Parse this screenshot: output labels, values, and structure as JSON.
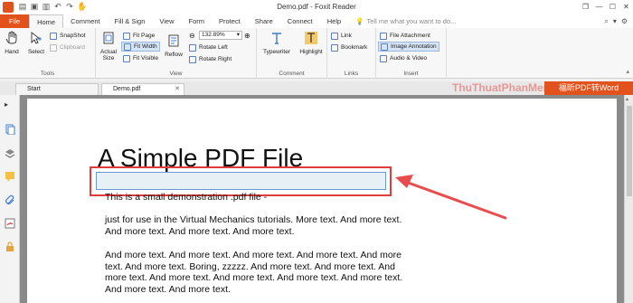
{
  "window": {
    "title": "Demo.pdf - Foxit Reader"
  },
  "qat_icons": [
    "open-icon",
    "save-icon",
    "print-icon",
    "undo-icon",
    "redo-icon",
    "hand-tool-icon"
  ],
  "window_controls": [
    "restore-icon",
    "minimize-icon",
    "maximize-icon",
    "close-icon"
  ],
  "tabs": [
    "File",
    "Home",
    "Comment",
    "Fill & Sign",
    "View",
    "Form",
    "Protect",
    "Share",
    "Connect",
    "Help"
  ],
  "active_tab": "Home",
  "tell_me": {
    "placeholder": "Tell me what you want to do..."
  },
  "ribbon": {
    "tools": {
      "label": "Tools",
      "hand": "Hand",
      "select": "Select",
      "snapshot": "SnapShot",
      "clipboard": "Clipboard"
    },
    "view": {
      "label": "View",
      "actual_size": [
        "Actual",
        "Size"
      ],
      "fit_page": "Fit Page",
      "fit_width": "Fit Width",
      "fit_visible": "Fit Visible",
      "reflow": "Reflow",
      "zoom": "132.89%",
      "rotate_left": "Rotate Left",
      "rotate_right": "Rotate Right"
    },
    "comment": {
      "label": "Comment",
      "typewriter": "Typewriter",
      "highlight": "Highlight"
    },
    "links": {
      "label": "Links",
      "link": "Link",
      "bookmark": "Bookmark"
    },
    "insert": {
      "label": "Insert",
      "file_attachment": "File Attachment",
      "image_annotation": "Image Annotation",
      "audio_video": "Audio & Video"
    }
  },
  "doc_tabs": [
    "Start",
    "Demo.pdf"
  ],
  "watermark": "ThuThuatPhanMem",
  "promo": "福昕PDF转Word",
  "sidebar_icons": [
    "bookmark-panel-icon",
    "pages-panel-icon",
    "layers-panel-icon",
    "comments-panel-icon",
    "attachments-panel-icon",
    "signature-panel-icon",
    "security-panel-icon"
  ],
  "pdf": {
    "title": "A Simple PDF File",
    "p1": "This is a small demonstration .pdf file -",
    "p2": "just for use in the Virtual Mechanics tutorials. More text. And more text. And more text. And more text. And more text.",
    "p3": "And more text. And more text. And more text. And more text. And more text. And more text. Boring, zzzzz. And more text. And more text. And more text. And more text. And more text. And more text. And more text. And more text. And more text."
  },
  "colors": {
    "brand": "#e2521d",
    "annotation_highlight": "#e03c3c"
  }
}
